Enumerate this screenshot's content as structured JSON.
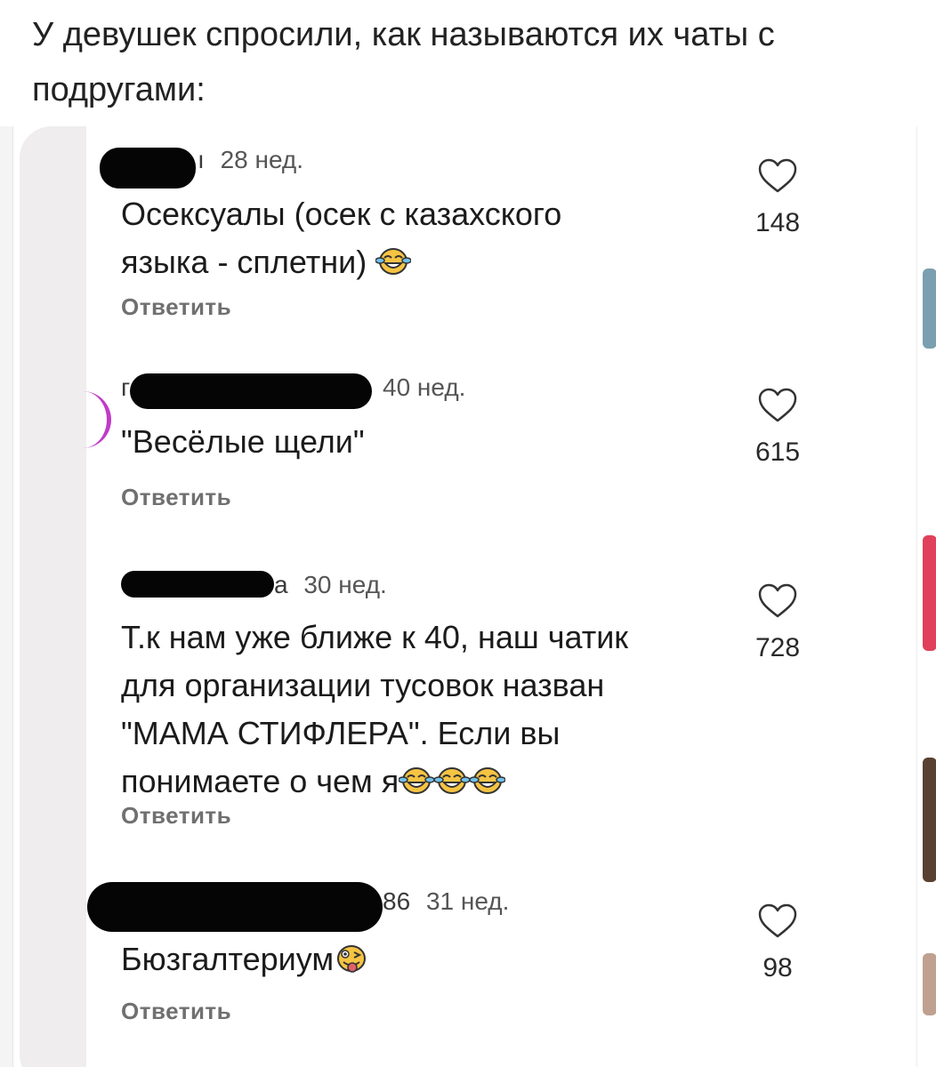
{
  "post": {
    "caption": "У девушек спросили, как называются их чаты с\nподругами:"
  },
  "comments": [
    {
      "username_visible": "ı",
      "date": "28 нед.",
      "text": "Осексуалы (осек с казахского\nязыка - сплетни)",
      "emoji": [
        "laughing-tears-emoji"
      ],
      "reply_label": "Ответить",
      "likes": "148"
    },
    {
      "username_visible": "г",
      "date": "40 нед.",
      "text": "\"Весёлые щели\"",
      "emoji": [],
      "reply_label": "Ответить",
      "likes": "615"
    },
    {
      "username_visible": "a",
      "date": "30 нед.",
      "text": "Т.к нам уже ближе к 40, наш чатик\nдля организации тусовок назван\n\"МАМА СТИФЛЕРА\". Если вы\nпонимаете о чем я",
      "emoji": [
        "laughing-tears-emoji",
        "laughing-tears-emoji",
        "laughing-tears-emoji"
      ],
      "reply_label": "Ответить",
      "likes": "728"
    },
    {
      "username_visible": "86",
      "date": "31 нед.",
      "text": "Бюзгалтериум",
      "emoji": [
        "zany-face-emoji"
      ],
      "reply_label": "Ответить",
      "likes": "98"
    }
  ],
  "icons": {
    "like": "heart-outline-icon"
  },
  "colors": {
    "text": "#1b1b1b",
    "secondary": "#707070",
    "story_ring": "#c13ac9",
    "redaction": "#050505"
  }
}
